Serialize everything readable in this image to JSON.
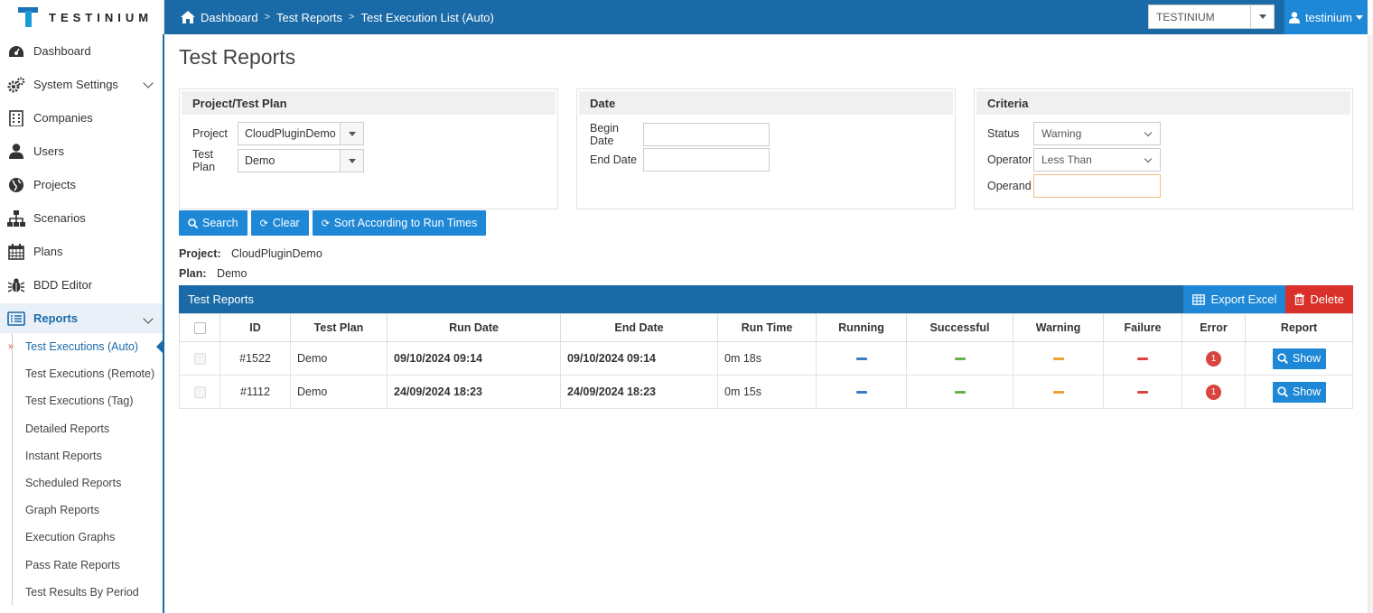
{
  "brand": {
    "name": "TESTINIUM"
  },
  "breadcrumb": [
    "Dashboard",
    "Test Reports",
    "Test Execution List (Auto)"
  ],
  "tenant_select": {
    "value": "TESTINIUM"
  },
  "user": {
    "name": "testinium"
  },
  "sidebar": {
    "items": [
      {
        "label": "Dashboard",
        "icon": "dashboard-icon"
      },
      {
        "label": "System Settings",
        "icon": "gears-icon"
      },
      {
        "label": "Companies",
        "icon": "building-icon"
      },
      {
        "label": "Users",
        "icon": "user-icon"
      },
      {
        "label": "Projects",
        "icon": "globe-icon"
      },
      {
        "label": "Scenarios",
        "icon": "sitemap-icon"
      },
      {
        "label": "Plans",
        "icon": "calendar-icon"
      },
      {
        "label": "BDD Editor",
        "icon": "bug-icon"
      },
      {
        "label": "Reports",
        "icon": "list-icon"
      }
    ],
    "report_sub_items": [
      "Test Executions (Auto)",
      "Test Executions (Remote)",
      "Test Executions (Tag)",
      "Detailed Reports",
      "Instant Reports",
      "Scheduled Reports",
      "Graph Reports",
      "Execution Graphs",
      "Pass Rate Reports",
      "Test Results By Period"
    ]
  },
  "page": {
    "title": "Test Reports"
  },
  "filters": {
    "project_panel": {
      "title": "Project/Test Plan",
      "project_label": "Project",
      "project_value": "CloudPluginDemo",
      "plan_label": "Test Plan",
      "plan_value": "Demo"
    },
    "date_panel": {
      "title": "Date",
      "begin_label": "Begin Date",
      "end_label": "End Date"
    },
    "criteria_panel": {
      "title": "Criteria",
      "status_label": "Status",
      "status_value": "Warning",
      "operator_label": "Operator",
      "operator_value": "Less Than",
      "operand_label": "Operand"
    }
  },
  "actions": {
    "search": "Search",
    "clear": "Clear",
    "sort": "Sort According to Run Times"
  },
  "summary": {
    "project_label": "Project:",
    "project_value": "CloudPluginDemo",
    "plan_label": "Plan:",
    "plan_value": "Demo"
  },
  "table": {
    "title": "Test Reports",
    "export_label": "Export Excel",
    "delete_label": "Delete",
    "columns": [
      "ID",
      "Test Plan",
      "Run Date",
      "End Date",
      "Run Time",
      "Running",
      "Successful",
      "Warning",
      "Failure",
      "Error",
      "Report"
    ],
    "rows": [
      {
        "id": "#1522",
        "plan": "Demo",
        "run_date": "09/10/2024 09:14",
        "end_date": "09/10/2024 09:14",
        "run_time": "0m 18s",
        "running": "—",
        "successful": "—",
        "warning": "—",
        "failure": "—",
        "error": "1",
        "report": "Show"
      },
      {
        "id": "#1112",
        "plan": "Demo",
        "run_date": "24/09/2024 18:23",
        "end_date": "24/09/2024 18:23",
        "run_time": "0m 15s",
        "running": "—",
        "successful": "—",
        "warning": "—",
        "failure": "—",
        "error": "1",
        "report": "Show"
      }
    ]
  },
  "colors": {
    "primary": "#1a6aa8",
    "button": "#1e88d6",
    "danger": "#d9302a",
    "running": "#3a7cc3",
    "successful": "#6ab04c",
    "warning": "#f0a030",
    "failure": "#d9453e"
  }
}
